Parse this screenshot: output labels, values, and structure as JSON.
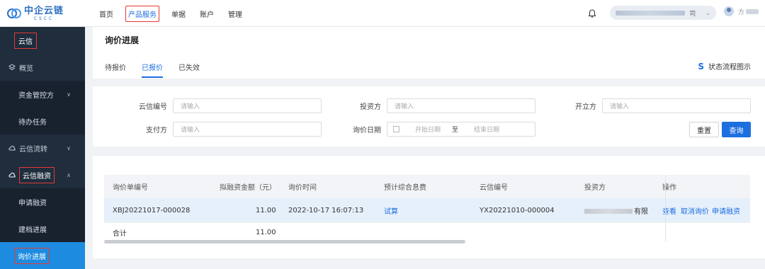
{
  "brand": {
    "name": "中企云链",
    "sub": "CSCC"
  },
  "topnav": [
    "首页",
    "产品服务",
    "单据",
    "账户",
    "管理"
  ],
  "topnav_active_index": 1,
  "header": {
    "company_suffix": "司",
    "user_initial": "方"
  },
  "sidebar": {
    "title": "云信",
    "items": [
      {
        "label": "概览",
        "icon": "layers-icon"
      },
      {
        "label": "资金管控方",
        "sub": true
      },
      {
        "label": "待办任务",
        "sub": true
      },
      {
        "label": "云信流转",
        "icon": "cloud-icon"
      },
      {
        "label": "云信融资",
        "icon": "cloud-money-icon"
      },
      {
        "label": "申请融资",
        "sub": true
      },
      {
        "label": "建档进展",
        "sub": true
      },
      {
        "label": "询价进展",
        "sub": true
      }
    ]
  },
  "page": {
    "title": "询价进展",
    "tabs": [
      "待报价",
      "已报价",
      "已失效"
    ],
    "active_tab": 1,
    "flow_link": "状态流程图示"
  },
  "filters": {
    "yunxin_no": {
      "label": "云信编号",
      "placeholder": "请输入"
    },
    "investor": {
      "label": "投资方",
      "placeholder": "请输入"
    },
    "issuer": {
      "label": "开立方",
      "placeholder": "请输入"
    },
    "payer": {
      "label": "支付方",
      "placeholder": "请输入"
    },
    "date": {
      "label": "询价日期",
      "start": "开始日期",
      "sep": "至",
      "end": "结束日期"
    },
    "reset": "重置",
    "search": "查询"
  },
  "table": {
    "headers": [
      "询价单编号",
      "拟融资金额（元）",
      "询价时间",
      "预计综合息费",
      "云信编号",
      "投资方",
      "操作"
    ],
    "row": {
      "id": "XBJ20221017-000028",
      "amount": "11.00",
      "time": "2022-10-17 16:07:13",
      "fee_link": "试算",
      "yunxin_no": "YX20221010-000004",
      "investor_suffix": "有限",
      "ops": [
        "查看",
        "取消询价",
        "申请融资"
      ]
    },
    "total": {
      "label": "合计",
      "amount": "11.00"
    }
  },
  "colors": {
    "primary": "#1d6fe0",
    "sidebar": "#1f2d3d",
    "highlight": "#e53935"
  }
}
